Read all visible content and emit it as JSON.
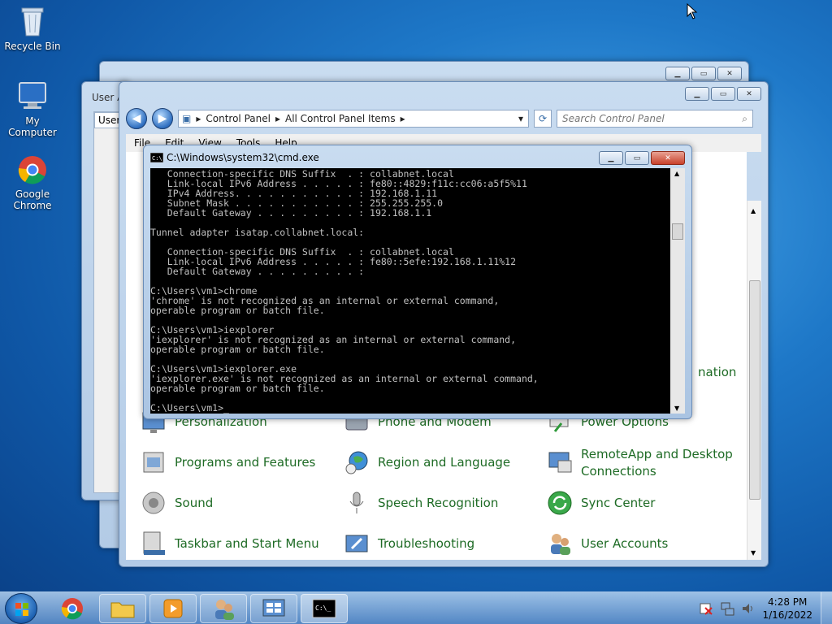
{
  "desktop": {
    "icons": [
      {
        "label": "Recycle Bin"
      },
      {
        "label": "My Computer"
      },
      {
        "label": "Google Chrome"
      }
    ]
  },
  "back_windows": {
    "user_accounts_title": "User A",
    "users_tab": "Users"
  },
  "control_panel": {
    "breadcrumb": [
      "Control Panel",
      "All Control Panel Items"
    ],
    "search_placeholder": "Search Control Panel",
    "menu": [
      "File",
      "Edit",
      "View",
      "Tools",
      "Help"
    ],
    "partial_item": "nation",
    "items": [
      {
        "label": "Personalization",
        "icon": "personalization-icon"
      },
      {
        "label": "Phone and Modem",
        "icon": "phone-modem-icon"
      },
      {
        "label": "Power Options",
        "icon": "power-options-icon"
      },
      {
        "label": "Programs and Features",
        "icon": "programs-features-icon"
      },
      {
        "label": "Region and Language",
        "icon": "region-language-icon"
      },
      {
        "label": "RemoteApp and Desktop Connections",
        "icon": "remoteapp-icon"
      },
      {
        "label": "Sound",
        "icon": "sound-icon"
      },
      {
        "label": "Speech Recognition",
        "icon": "speech-recognition-icon"
      },
      {
        "label": "Sync Center",
        "icon": "sync-center-icon"
      },
      {
        "label": "Taskbar and Start Menu",
        "icon": "taskbar-start-icon"
      },
      {
        "label": "Troubleshooting",
        "icon": "troubleshooting-icon"
      },
      {
        "label": "User Accounts",
        "icon": "user-accounts-icon"
      }
    ]
  },
  "cmd": {
    "title": "C:\\Windows\\system32\\cmd.exe",
    "output": "   Connection-specific DNS Suffix  . : collabnet.local\n   Link-local IPv6 Address . . . . . : fe80::4829:f11c:cc06:a5f5%11\n   IPv4 Address. . . . . . . . . . . : 192.168.1.11\n   Subnet Mask . . . . . . . . . . . : 255.255.255.0\n   Default Gateway . . . . . . . . . : 192.168.1.1\n\nTunnel adapter isatap.collabnet.local:\n\n   Connection-specific DNS Suffix  . : collabnet.local\n   Link-local IPv6 Address . . . . . : fe80::5efe:192.168.1.11%12\n   Default Gateway . . . . . . . . . :\n\nC:\\Users\\vm1>chrome\n'chrome' is not recognized as an internal or external command,\noperable program or batch file.\n\nC:\\Users\\vm1>iexplorer\n'iexplorer' is not recognized as an internal or external command,\noperable program or batch file.\n\nC:\\Users\\vm1>iexplorer.exe\n'iexplorer.exe' is not recognized as an internal or external command,\noperable program or batch file.\n\nC:\\Users\\vm1>_"
  },
  "taskbar": {
    "time": "4:28 PM",
    "date": "1/16/2022"
  }
}
